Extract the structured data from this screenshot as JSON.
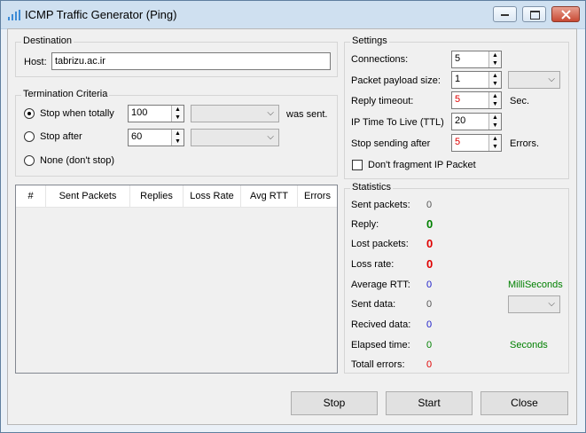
{
  "window": {
    "title": "ICMP Traffic Generator (Ping)"
  },
  "destination": {
    "group_label": "Destination",
    "host_label": "Host:",
    "host_value": "tabrizu.ac.ir"
  },
  "termination": {
    "group_label": "Termination Criteria",
    "stop_totally_label": "Stop when totally",
    "stop_totally_value": "100",
    "was_sent_label": "was sent.",
    "stop_after_label": "Stop after",
    "stop_after_value": "60",
    "none_label": "None (don't stop)",
    "selected": "stop_totally"
  },
  "table": {
    "columns": [
      "#",
      "Sent Packets",
      "Replies",
      "Loss Rate",
      "Avg RTT",
      "Errors"
    ]
  },
  "settings": {
    "group_label": "Settings",
    "connections_label": "Connections:",
    "connections_value": "5",
    "payload_label": "Packet payload size:",
    "payload_value": "1",
    "reply_timeout_label": "Reply timeout:",
    "reply_timeout_value": "5",
    "sec_label": "Sec.",
    "ttl_label": "IP Time To Live (TTL)",
    "ttl_value": "20",
    "stop_sending_label": "Stop sending after",
    "stop_sending_value": "5",
    "errors_label": "Errors.",
    "dont_fragment_label": "Don't fragment IP Packet"
  },
  "statistics": {
    "group_label": "Statistics",
    "sent_packets_label": "Sent packets:",
    "sent_packets_value": "0",
    "reply_label": "Reply:",
    "reply_value": "0",
    "lost_label": "Lost packets:",
    "lost_value": "0",
    "loss_rate_label": "Loss rate:",
    "loss_rate_value": "0",
    "avg_rtt_label": "Average RTT:",
    "avg_rtt_value": "0",
    "ms_label": "MilliSeconds",
    "sent_data_label": "Sent data:",
    "sent_data_value": "0",
    "recv_data_label": "Recived data:",
    "recv_data_value": "0",
    "elapsed_label": "Elapsed time:",
    "elapsed_value": "0",
    "seconds_label": "Seconds",
    "total_errors_label": "Totall errors:",
    "total_errors_value": "0"
  },
  "buttons": {
    "stop": "Stop",
    "start": "Start",
    "close": "Close"
  },
  "colors": {
    "green": "#008000",
    "red": "#e00000",
    "blue": "#1a1ac8",
    "gray": "#555555"
  }
}
